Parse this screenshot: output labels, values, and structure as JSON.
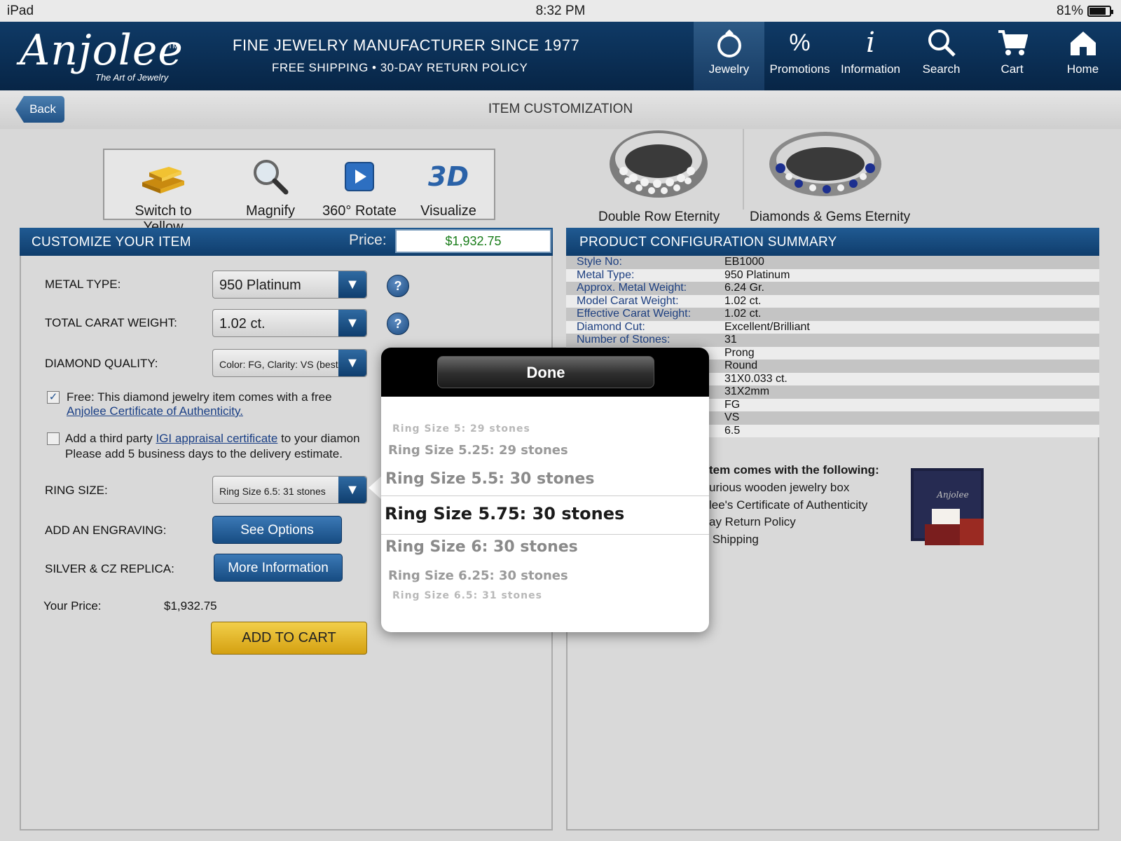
{
  "status": {
    "device": "iPad",
    "time": "8:32 PM",
    "battery": "81%"
  },
  "header": {
    "logo": "Anjolee",
    "logo_tm": "TM",
    "logo_sub": "The Art of Jewelry",
    "tagline1": "FINE JEWELRY MANUFACTURER SINCE 1977",
    "tagline2": "FREE SHIPPING  •  30-DAY RETURN POLICY",
    "nav": [
      {
        "label": "Jewelry",
        "icon": "ring-icon"
      },
      {
        "label": "Promotions",
        "icon": "percent-icon"
      },
      {
        "label": "Information",
        "icon": "info-icon"
      },
      {
        "label": "Search",
        "icon": "search-icon"
      },
      {
        "label": "Cart",
        "icon": "cart-icon"
      },
      {
        "label": "Home",
        "icon": "home-icon"
      }
    ]
  },
  "titlebar": {
    "back": "Back",
    "title": "ITEM CUSTOMIZATION"
  },
  "tools": [
    {
      "label": "Switch to Yellow",
      "icon": "gold-bars-icon"
    },
    {
      "label": "Magnify",
      "icon": "magnifier-icon"
    },
    {
      "label": "360° Rotate",
      "icon": "play-icon"
    },
    {
      "label": "Visualize",
      "icon": "3d-icon"
    }
  ],
  "customize": {
    "title": "CUSTOMIZE YOUR ITEM",
    "price_label": "Price:",
    "price": "$1,932.75",
    "metal_label": "METAL TYPE:",
    "metal_value": "950 Platinum",
    "carat_label": "TOTAL CARAT WEIGHT:",
    "carat_value": "1.02 ct.",
    "quality_label": "DIAMOND QUALITY:",
    "quality_value": "Color: FG, Clarity: VS (best)",
    "free_cert_text": "Free: This diamond jewelry item comes with a free",
    "free_cert_link": "Anjolee Certificate of  Authenticity.",
    "igi_text1": "Add a third party",
    "igi_link": "IGI appraisal certificate",
    "igi_text2": "to your diamon",
    "igi_text3": "Please add 5 business days to the delivery estimate.",
    "ring_label": "RING SIZE:",
    "ring_value": "Ring Size 6.5: 31 stones",
    "engraving_label": "ADD AN ENGRAVING:",
    "engraving_btn": "See Options",
    "replica_label": "SILVER & CZ REPLICA:",
    "replica_btn": "More Information",
    "your_price_label": "Your Price:",
    "your_price": "$1,932.75",
    "add_to_cart": "ADD TO CART"
  },
  "related": [
    {
      "caption": "Double Row Eternity"
    },
    {
      "caption": "Diamonds & Gems Eternity"
    }
  ],
  "summary": {
    "title": "PRODUCT CONFIGURATION SUMMARY",
    "rows": [
      {
        "k": "Style No:",
        "v": "EB1000"
      },
      {
        "k": "Metal Type:",
        "v": "950 Platinum"
      },
      {
        "k": "Approx. Metal Weight:",
        "v": "6.24 Gr."
      },
      {
        "k": "Model Carat Weight:",
        "v": "1.02 ct."
      },
      {
        "k": "Effective Carat Weight:",
        "v": "1.02 ct."
      },
      {
        "k": "Diamond Cut:",
        "v": "Excellent/Brilliant"
      },
      {
        "k": "Number of Stones:",
        "v": "31"
      },
      {
        "k": "",
        "v": "Prong"
      },
      {
        "k": "",
        "v": "Round"
      },
      {
        "k": "",
        "v": "31X0.033 ct."
      },
      {
        "k": "",
        "v": "31X2mm"
      },
      {
        "k": "",
        "v": "FG"
      },
      {
        "k": "",
        "v": "VS"
      },
      {
        "k": "",
        "v": "6.5"
      }
    ],
    "includes_title": "tem comes with the following:",
    "includes": [
      "urious wooden jewelry box",
      "lee's Certificate of Authenticity",
      "ay Return Policy",
      " Shipping"
    ]
  },
  "picker": {
    "done": "Done",
    "options": [
      "Ring Size 5: 29 stones",
      "Ring Size 5.25: 29 stones",
      "Ring Size 5.5: 30 stones",
      "Ring Size 5.75: 30 stones",
      "Ring Size 6: 30 stones",
      "Ring Size 6.25: 30 stones",
      "Ring Size 6.5: 31 stones"
    ],
    "selected_index": 3
  }
}
